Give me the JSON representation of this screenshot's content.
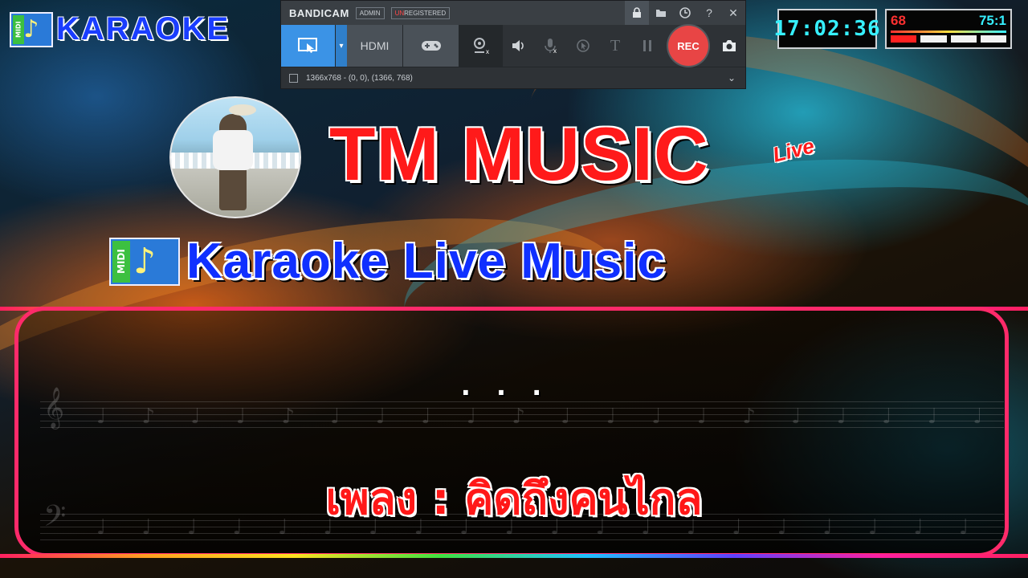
{
  "logo": {
    "badge": "MIDI",
    "text": "KARAOKE"
  },
  "bandicam": {
    "brand": "BANDICAM",
    "badge_admin": "ADMIN",
    "badge_unreg_prefix": "UN",
    "badge_unreg_rest": "REGISTERED",
    "modes": {
      "hdmi": "HDMI"
    },
    "rec_label": "REC",
    "text_tool": "T",
    "status": "1366x768 - (0, 0), (1366, 768)"
  },
  "clock": "17:02:36",
  "meter": {
    "left": "68",
    "right": "75:1"
  },
  "titles": {
    "main": "TM MUSIC",
    "live": "Live",
    "sub": "Karaoke Live Music",
    "midi_badge": "MIDI"
  },
  "lyrics": {
    "dots": "...",
    "song": "เพลง : คิดถึงคนไกล"
  },
  "colors": {
    "accent_red": "#ff1a1a",
    "accent_blue": "#1030ff",
    "panel_border": "#ff2a6a",
    "bandicam_blue": "#3b93e6"
  },
  "icons": [
    "music-note-icon",
    "lock-icon",
    "folder-icon",
    "clock-icon",
    "help-icon",
    "close-icon",
    "screen-select-icon",
    "gamepad-icon",
    "webcam-icon",
    "speaker-icon",
    "microphone-icon",
    "cursor-icon",
    "pause-icon",
    "camera-icon",
    "chevron-down-icon"
  ]
}
